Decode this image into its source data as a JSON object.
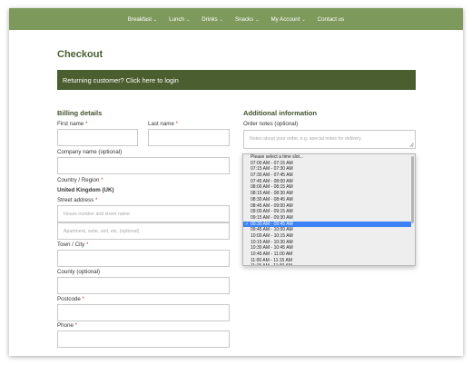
{
  "nav": {
    "items": [
      {
        "label": "Breakfast",
        "has_dropdown": true
      },
      {
        "label": "Lunch",
        "has_dropdown": true
      },
      {
        "label": "Drinks",
        "has_dropdown": true
      },
      {
        "label": "Snacks",
        "has_dropdown": true
      },
      {
        "label": "My Account",
        "has_dropdown": true
      },
      {
        "label": "Contact us",
        "has_dropdown": false
      }
    ],
    "chevron": "⌄"
  },
  "page": {
    "title": "Checkout",
    "notice": "Returning customer? Click here to login"
  },
  "billing": {
    "heading": "Billing details",
    "first_name_label": "First name",
    "last_name_label": "Last name",
    "company_label": "Company name (optional)",
    "country_label": "Country / Region",
    "country_value": "United Kingdom (UK)",
    "street_label": "Street address",
    "street_placeholder_1": "House number and street name",
    "street_placeholder_2": "Apartment, suite, unit, etc. (optional)",
    "town_label": "Town / City",
    "county_label": "County (optional)",
    "postcode_label": "Postcode",
    "phone_label": "Phone",
    "required_mark": "*"
  },
  "additional": {
    "heading": "Additional information",
    "notes_label": "Order notes (optional)",
    "notes_placeholder": "Notes about your order, e.g. special notes for delivery.",
    "time_slots": [
      "Please select a time slot...",
      "07:00 AM - 07:15 AM",
      "07:15 AM - 07:30 AM",
      "07:30 AM - 07:45 AM",
      "07:45 AM - 08:00 AM",
      "08:00 AM - 08:15 AM",
      "08:15 AM - 08:30 AM",
      "08:30 AM - 08:45 AM",
      "08:45 AM - 09:00 AM",
      "09:00 AM - 09:15 AM",
      "09:15 AM - 09:30 AM",
      "09:30 AM - 09:45 AM",
      "09:45 AM - 10:00 AM",
      "10:00 AM - 10:15 AM",
      "10:15 AM - 10:30 AM",
      "10:30 AM - 10:45 AM",
      "10:45 AM - 11:00 AM",
      "11:00 AM - 11:15 AM",
      "11:15 AM - 11:30 AM",
      "11:30 AM - 11:45 AM"
    ],
    "selected_slot": "09:30 AM - 09:45 AM",
    "check_mark": "✓"
  },
  "colors": {
    "nav_bg": "#7d9a5c",
    "notice_bg": "#4b5e30",
    "heading": "#3f4f2d",
    "selected_option": "#3c82f6",
    "required": "#c0392b"
  }
}
